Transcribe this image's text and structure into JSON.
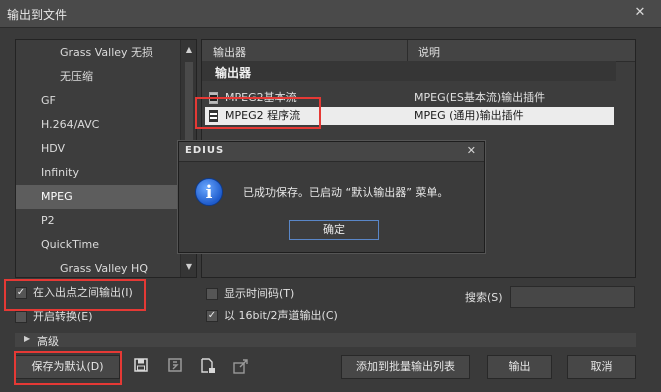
{
  "window": {
    "title": "输出到文件",
    "close_label": "✕"
  },
  "left_list": {
    "items": [
      {
        "label": "Grass Valley 无损",
        "indent": true
      },
      {
        "label": "无压缩",
        "indent": true
      },
      {
        "label": "GF",
        "indent": false
      },
      {
        "label": "H.264/AVC",
        "indent": false
      },
      {
        "label": "HDV",
        "indent": false
      },
      {
        "label": "Infinity",
        "indent": false
      },
      {
        "label": "MPEG",
        "indent": false,
        "selected": true
      },
      {
        "label": "P2",
        "indent": false
      },
      {
        "label": "QuickTime",
        "indent": false
      },
      {
        "label": "Grass Valley HQ",
        "indent": true
      }
    ]
  },
  "exporter_table": {
    "columns": [
      "输出器",
      "说明"
    ],
    "group": "输出器",
    "rows": [
      {
        "name": "MPEG2基本流",
        "desc": "MPEG(ES基本流)输出插件",
        "selected": false
      },
      {
        "name": "MPEG2 程序流",
        "desc": "MPEG (通用)输出插件",
        "selected": true
      }
    ]
  },
  "dialog": {
    "title": "EDIUS",
    "close_label": "✕",
    "icon": "info-icon",
    "message": "已成功保存。已启动 “默认输出器” 菜单。",
    "ok_label": "确定"
  },
  "options": {
    "in_out_label": "在入出点之间输出(I)",
    "in_out_checked": true,
    "convert_label": "开启转换(E)",
    "convert_checked": false,
    "timecode_label": "显示时间码(T)",
    "timecode_checked": false,
    "audio16_label": "以 16bit/2声道输出(C)",
    "audio16_checked": true
  },
  "search": {
    "label": "搜索(S)",
    "value": ""
  },
  "advanced": {
    "label": "高级"
  },
  "footer": {
    "save_default_label": "保存为默认(D)",
    "add_batch_label": "添加到批量输出列表",
    "export_label": "输出",
    "cancel_label": "取消",
    "icons": [
      "save-icon",
      "save-as-icon",
      "load-preset-icon",
      "export-preset-icon"
    ]
  },
  "colors": {
    "highlight_box": "#e53935",
    "selection": "#ececec",
    "dialog_button_border": "#5a87c8"
  }
}
